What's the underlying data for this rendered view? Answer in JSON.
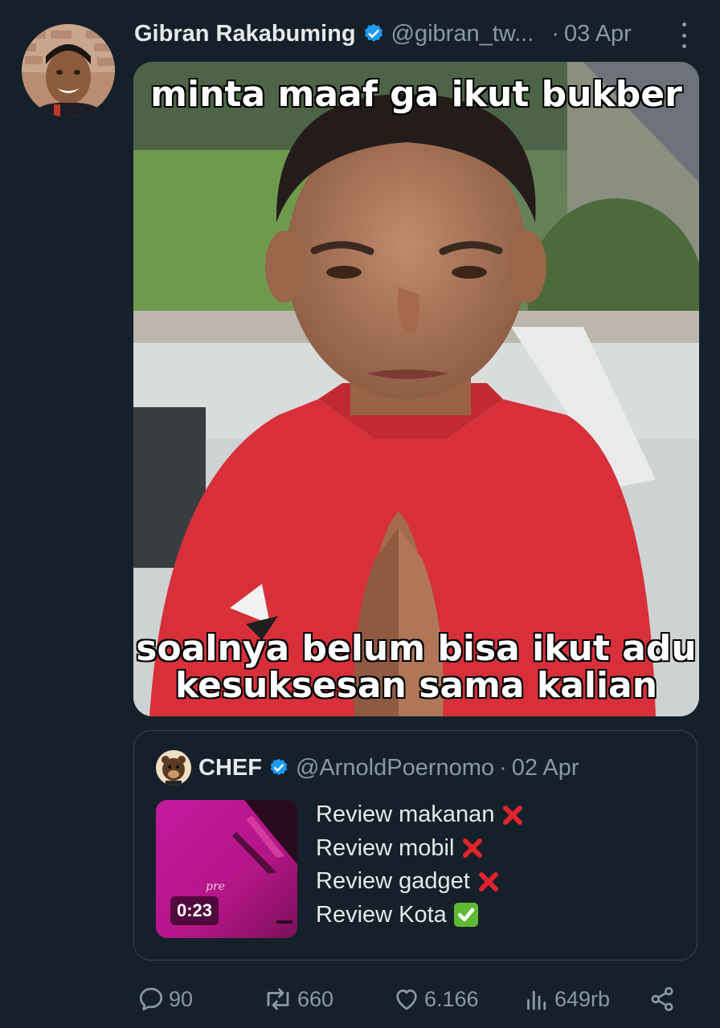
{
  "tweet": {
    "author_name": "Gibran Rakabuming",
    "handle": "@gibran_tw...",
    "separator": "·",
    "date": "03 Apr",
    "more_icon": "more-vertical-icon",
    "verified_icon": "verified-badge-icon"
  },
  "media": {
    "caption_top": "minta maaf ga ikut bukber",
    "caption_bottom_1": "soalnya belum bisa ikut adu",
    "caption_bottom_2": "kesuksesan sama kalian"
  },
  "quote": {
    "author_name": "CHEF",
    "handle": "@ArnoldPoernomo",
    "separator": "·",
    "date": "02 Apr",
    "video_duration": "0:23",
    "thumb_text": "pre",
    "lines": [
      {
        "text": "Review makanan",
        "mark": "cross-mark-icon"
      },
      {
        "text": "Review mobil",
        "mark": "cross-mark-icon"
      },
      {
        "text": "Review gadget",
        "mark": "cross-mark-icon"
      },
      {
        "text": "Review Kota",
        "mark": "check-mark-icon"
      }
    ]
  },
  "actions": {
    "replies": "90",
    "retweets": "660",
    "likes": "6.166",
    "views": "649rb"
  },
  "colors": {
    "background": "#15202b",
    "verified": "#1d9bf0",
    "muted": "#8b98a5",
    "border": "#38444d"
  }
}
